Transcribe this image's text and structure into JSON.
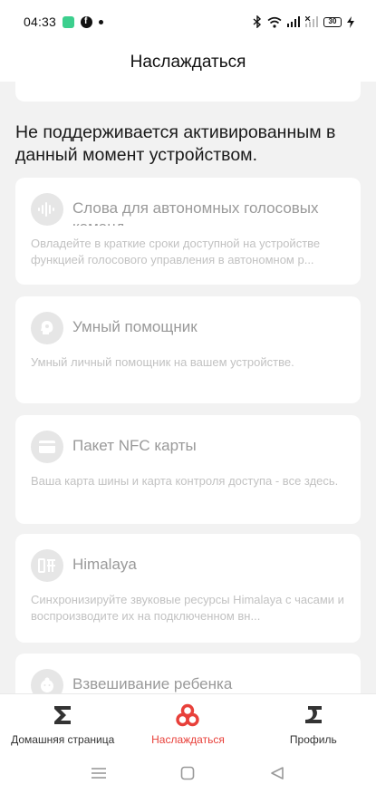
{
  "status_bar": {
    "time": "04:33",
    "battery": "30"
  },
  "header": {
    "title": "Наслаждаться"
  },
  "notice": "Не поддерживается активированным в данный момент устройством.",
  "cards": [
    {
      "icon": "voice-waveform-icon",
      "title": "Слова для автономных голосовых команд",
      "description": "Овладейте в краткие сроки доступной на устройстве функцией голосового управления в автономном р..."
    },
    {
      "icon": "assistant-head-icon",
      "title": "Умный помощник",
      "description": "Умный личный помощник на вашем устройстве."
    },
    {
      "icon": "nfc-card-icon",
      "title": "Пакет NFC карты",
      "description": "Ваша карта шины и карта контроля доступа - все здесь."
    },
    {
      "icon": "himalaya-icon",
      "title": "Himalaya",
      "description": "Синхронизируйте звуковые ресурсы Himalaya с часами и воспроизводите их на подключенном вн..."
    },
    {
      "icon": "baby-icon",
      "title": "Взвешивание ребенка",
      "description": ""
    }
  ],
  "tabs": [
    {
      "label": "Домашняя страница",
      "icon": "home-sigma-icon",
      "active": false
    },
    {
      "label": "Наслаждаться",
      "icon": "enjoy-icon",
      "active": true
    },
    {
      "label": "Профиль",
      "icon": "profile-icon",
      "active": false
    }
  ],
  "colors": {
    "accent": "#e8403a",
    "background": "#f2f2f2",
    "card": "#ffffff",
    "disabled_text": "#9a9a9a"
  }
}
